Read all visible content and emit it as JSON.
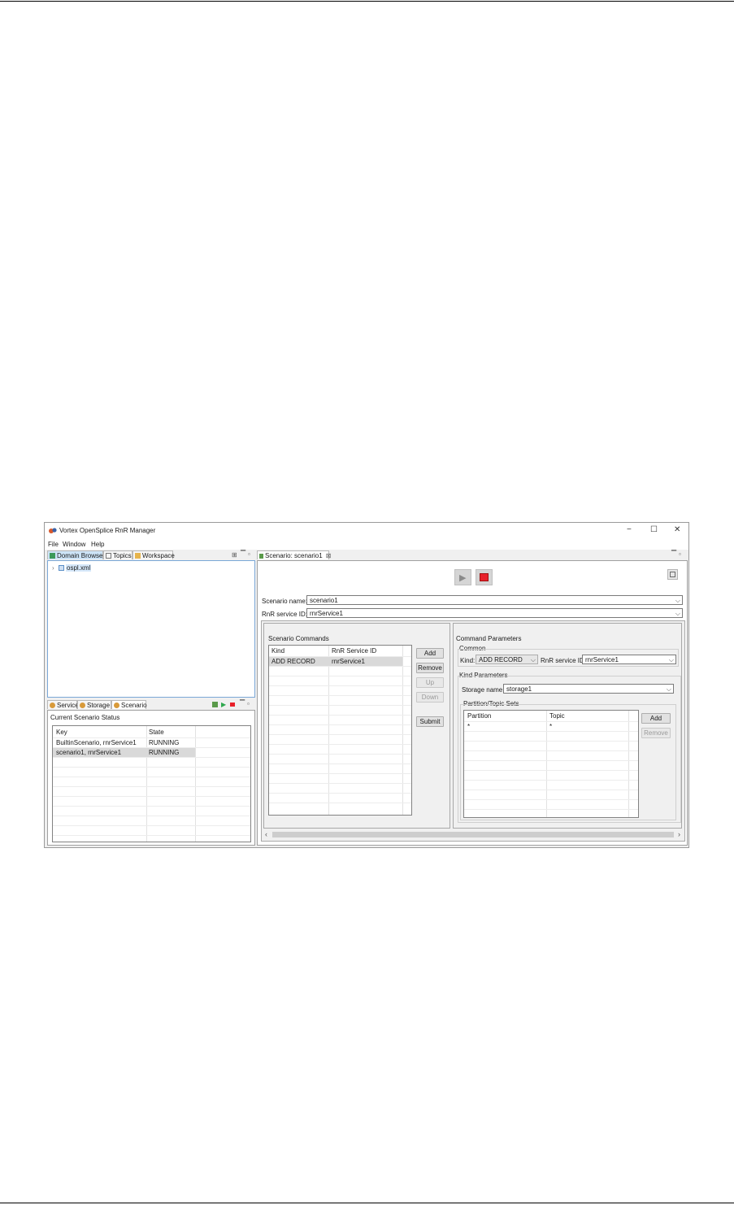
{
  "window": {
    "title": "Vortex OpenSplice RnR Manager",
    "controls": {
      "minimize": "−",
      "maximize": "☐",
      "close": "✕"
    }
  },
  "menu": {
    "file": "File",
    "window": "Window",
    "help": "Help"
  },
  "left_top_tabs": {
    "domain_browser": "Domain Browser",
    "topics": "Topics",
    "workspace": "Workspace"
  },
  "tree": {
    "item": "ospl.xml"
  },
  "left_bottom_tabs": {
    "service": "Service",
    "storage": "Storage",
    "scenario": "Scenario"
  },
  "status_panel": {
    "title": "Current Scenario Status",
    "columns": {
      "key": "Key",
      "state": "State"
    },
    "rows": [
      {
        "key": "BuiltinScenario, rnrService1",
        "state": "RUNNING"
      },
      {
        "key": "scenario1, rnrService1",
        "state": "RUNNING"
      }
    ]
  },
  "editor": {
    "tab_label": "Scenario: scenario1",
    "scenario_name_label": "Scenario name:",
    "scenario_name_value": "scenario1",
    "service_id_label": "RnR service ID:",
    "service_id_value": "rnrService1"
  },
  "commands": {
    "title": "Scenario Commands",
    "columns": {
      "kind": "Kind",
      "service": "RnR Service ID"
    },
    "rows": [
      {
        "kind": "ADD RECORD",
        "service": "rnrService1"
      }
    ],
    "buttons": {
      "add": "Add",
      "remove": "Remove",
      "up": "Up",
      "down": "Down",
      "submit": "Submit"
    }
  },
  "params": {
    "title": "Command Parameters",
    "common_label": "Common",
    "kind_label": "Kind:",
    "kind_value": "ADD RECORD",
    "service_label": "RnR service ID:",
    "service_value": "rnrService1",
    "kind_params_label": "Kind Parameters",
    "storage_label": "Storage name:",
    "storage_value": "storage1",
    "pts_label": "Partition/Topic Sets",
    "columns": {
      "partition": "Partition",
      "topic": "Topic"
    },
    "rows": [
      {
        "partition": "*",
        "topic": "*"
      }
    ],
    "buttons": {
      "add": "Add",
      "remove": "Remove"
    }
  },
  "colors": {
    "accent": "#cde4f7",
    "stop": "#e8202a",
    "play": "#2fa84f"
  }
}
